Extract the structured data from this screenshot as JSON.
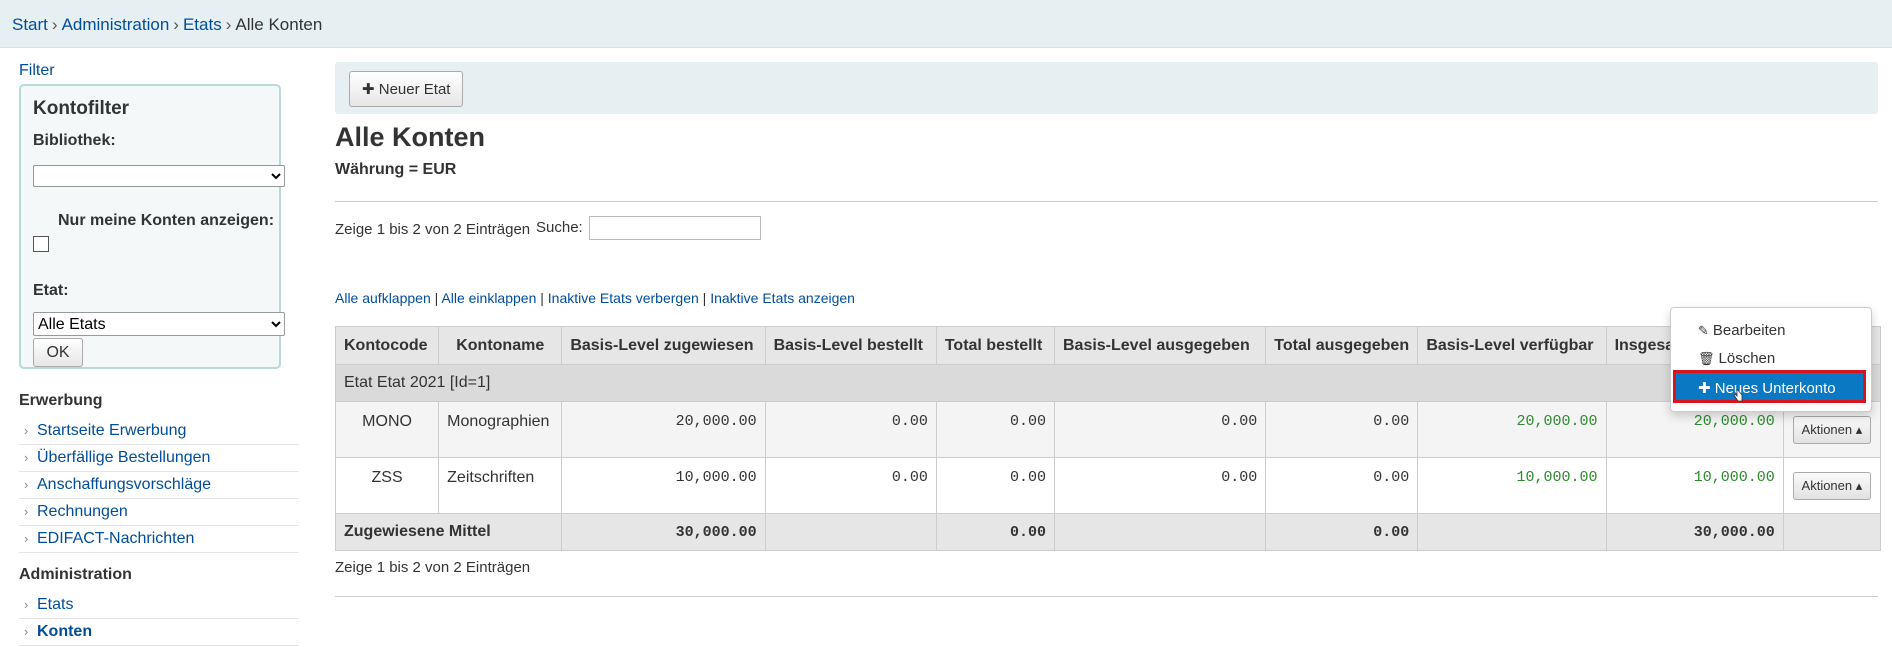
{
  "breadcrumb": {
    "start": "Start",
    "administration": "Administration",
    "etats": "Etats",
    "current": "Alle Konten",
    "separator": "›"
  },
  "sidebar": {
    "filter_link": "Filter",
    "filter_box": {
      "title": "Kontofilter",
      "library_label": "Bibliothek:",
      "library_value": "",
      "only_mine_label": "Nur meine Konten anzeigen:",
      "only_mine_checked": false,
      "etat_label": "Etat:",
      "etat_value": "Alle Etats",
      "ok_label": "OK"
    },
    "section_acquisition": "Erwerbung",
    "acquisition_items": [
      {
        "label": "Startseite Erwerbung"
      },
      {
        "label": "Überfällige Bestellungen"
      },
      {
        "label": "Anschaffungsvorschläge"
      },
      {
        "label": "Rechnungen"
      },
      {
        "label": "EDIFACT-Nachrichten"
      }
    ],
    "section_admin": "Administration",
    "admin_items": [
      {
        "label": "Etats"
      },
      {
        "label": "Konten"
      }
    ]
  },
  "toolbar": {
    "new_etat_label": "Neuer Etat",
    "plus_icon": "✚"
  },
  "main": {
    "title": "Alle Konten",
    "currency": "Währung = EUR",
    "info_top": "Zeige 1 bis 2 von 2 Einträgen",
    "search_label": "Suche:",
    "search_value": "",
    "links": {
      "expand": "Alle aufklappen",
      "collapse": "Alle einklappen",
      "hide_inactive": "Inaktive Etats verbergen",
      "show_inactive": "Inaktive Etats anzeigen",
      "sep": "|"
    },
    "info_bottom": "Zeige 1 bis 2 von 2 Einträgen"
  },
  "table": {
    "headers": [
      "Kontocode",
      "Kontoname",
      "Basis-Level zugewiesen",
      "Basis-Level bestellt",
      "Total bestellt",
      "Basis-Level ausgegeben",
      "Total ausgegeben",
      "Basis-Level verfügbar",
      "Insgesamt verfügbar",
      ""
    ],
    "group_label": "Etat Etat 2021 [Id=1]",
    "rows": [
      {
        "code": "MONO",
        "name": "Monographien",
        "v1": "20,000.00",
        "v2": "0.00",
        "v3": "0.00",
        "v4": "0.00",
        "v5": "0.00",
        "v6": "20,000.00",
        "v7": "20,000.00",
        "actions": "Aktionen ▴"
      },
      {
        "code": "ZSS",
        "name": "Zeitschriften",
        "v1": "10,000.00",
        "v2": "0.00",
        "v3": "0.00",
        "v4": "0.00",
        "v5": "0.00",
        "v6": "10,000.00",
        "v7": "10,000.00",
        "actions": "Aktionen ▴"
      }
    ],
    "total": {
      "label": "Zugewiesene Mittel",
      "v1": "30,000.00",
      "v3": "0.00",
      "v5": "0.00",
      "v7": "30,000.00"
    }
  },
  "dropdown": {
    "edit": "Bearbeiten",
    "delete": "Löschen",
    "new_subaccount": "Neues Unterkonto",
    "edit_icon": "pencil-icon",
    "delete_icon": "trash-icon",
    "new_icon": "plus-icon"
  },
  "colors": {
    "link": "#004d99",
    "positive": "#2d8b2d",
    "highlight": "#0a78c2",
    "annotation": "#d9141f"
  }
}
